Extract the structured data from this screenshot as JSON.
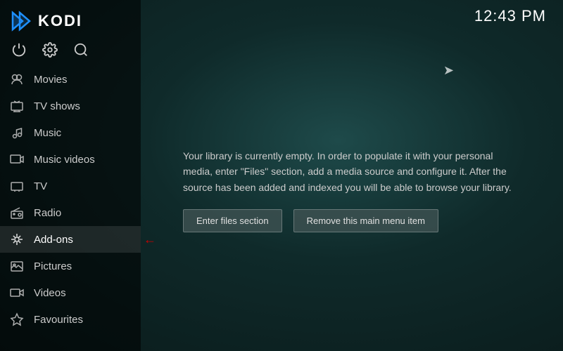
{
  "app": {
    "name": "KODI",
    "clock": "12:43 PM"
  },
  "sidebar": {
    "nav_items": [
      {
        "id": "movies",
        "label": "Movies",
        "icon": "people-icon"
      },
      {
        "id": "tvshows",
        "label": "TV shows",
        "icon": "tv-icon"
      },
      {
        "id": "music",
        "label": "Music",
        "icon": "music-icon"
      },
      {
        "id": "musicvideos",
        "label": "Music videos",
        "icon": "musicvideo-icon"
      },
      {
        "id": "tv",
        "label": "TV",
        "icon": "tv2-icon"
      },
      {
        "id": "radio",
        "label": "Radio",
        "icon": "radio-icon"
      },
      {
        "id": "addons",
        "label": "Add-ons",
        "icon": "addons-icon",
        "has_arrow": true
      },
      {
        "id": "pictures",
        "label": "Pictures",
        "icon": "pictures-icon"
      },
      {
        "id": "videos",
        "label": "Videos",
        "icon": "videos-icon"
      },
      {
        "id": "favourites",
        "label": "Favourites",
        "icon": "favourites-icon"
      }
    ],
    "toolbar": {
      "power_label": "power",
      "settings_label": "settings",
      "search_label": "search"
    }
  },
  "main": {
    "library_message": "Your library is currently empty. In order to populate it with your personal media, enter \"Files\" section, add a media source and configure it. After the source has been added and indexed you will be able to browse your library.",
    "btn_enter_files": "Enter files section",
    "btn_remove_item": "Remove this main menu item"
  }
}
